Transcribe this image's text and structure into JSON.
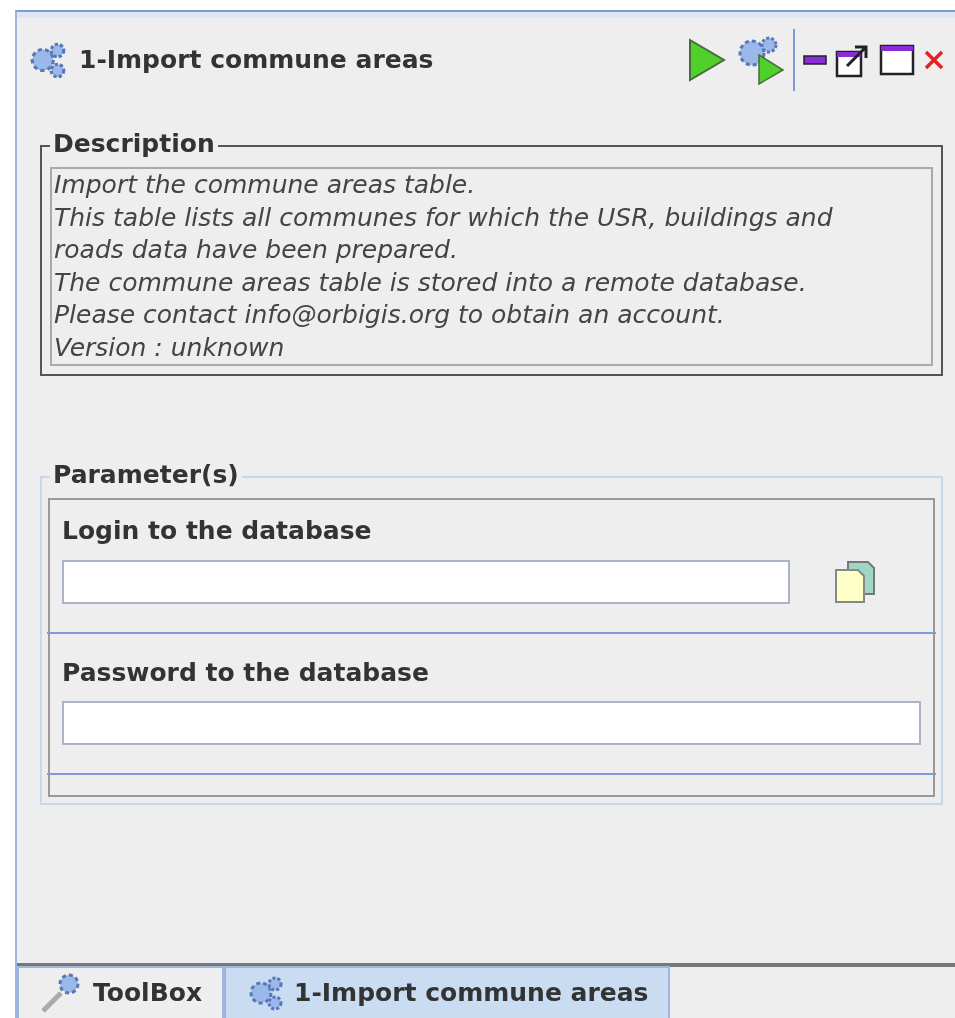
{
  "panel": {
    "title": "1-Import commune areas"
  },
  "description": {
    "legend": "Description",
    "lines": [
      "Import the commune areas table.",
      "This table lists all communes for which the USR, buildings and",
      "roads data have been prepared.",
      "The commune areas table is stored into a remote database.",
      "Please contact info@orbigis.org to obtain an account.",
      "Version : unknown"
    ]
  },
  "parameters": {
    "legend": "Parameter(s)",
    "items": [
      {
        "label": "Login to the database",
        "kind": "field-with-picker"
      },
      {
        "label": "Password to the database",
        "kind": "field"
      }
    ]
  },
  "tabs": [
    {
      "label": "ToolBox",
      "kind": "toolbox",
      "selected": false
    },
    {
      "label": "1-Import commune areas",
      "kind": "process",
      "selected": true
    }
  ]
}
